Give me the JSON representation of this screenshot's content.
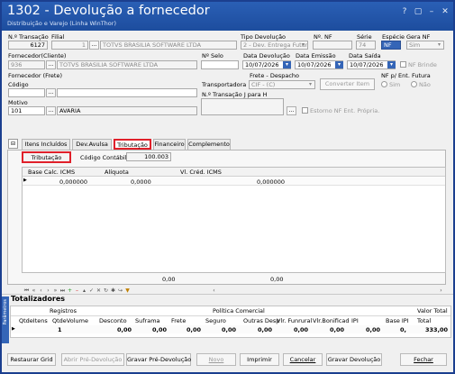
{
  "window": {
    "title": "1302 - Devolução a fornecedor",
    "subtitle": "Distribuição e Varejo (Linha WinThor)",
    "controls": [
      "?",
      "▢",
      "–",
      "✕"
    ]
  },
  "form": {
    "nr_transacao_label": "N.º Transação",
    "nr_transacao": "6127",
    "filial_label": "Filial",
    "filial_code": "1",
    "filial_name": "TOTVS BRASILIA SOFTWARE LTDA",
    "tipo_devolucao_label": "Tipo Devolução",
    "tipo_devolucao": "2 - Dev. Entrega Futur",
    "nr_nf_label": "Nº. NF",
    "serie_label": "Série",
    "serie": "74",
    "especie_label": "Espécie",
    "especie": "NF",
    "gera_nf_label": "Gera NF",
    "gera_nf": "Sim",
    "fornecedor_cliente_label": "Fornecedor(Cliente)",
    "fornecedor_code": "936",
    "fornecedor_name": "TOTVS BRASILIA SOFTWARE LTDA",
    "nr_selo_label": "Nº Selo",
    "data_devolucao_label": "Data Devolução",
    "data_devolucao": "10/07/2026",
    "data_emissao_label": "Data Emissão",
    "data_emissao": "10/07/2026",
    "data_saida_label": "Data Saída",
    "data_saida": "10/07/2026",
    "nf_brinde_label": "NF Brinde",
    "fornecedor_frete_label": "Fornecedor (Frete)",
    "codigo_label": "Código",
    "frete_despacho_label": "Frete - Despacho",
    "transportadora_label": "Transportadora",
    "frete_despacho": "CIF - (C)",
    "converter_item_label": "Converter Item",
    "nf_ent_futura_label": "NF p/ Ent. Futura",
    "sim_label": "Sim",
    "nao_label": "Não",
    "motivo_label": "Motivo",
    "motivo_code": "101",
    "motivo_desc": "AVARIA",
    "nr_transacao_j_label": "N.º Transação J para H",
    "estorno_label": "Estorno NF Ent. Própria.",
    "ellipsis": "..."
  },
  "tabs": [
    "Itens Incluídos",
    "Dev.Avulsa",
    "Tributação",
    "Financeiro",
    "Complemento"
  ],
  "tributacao": {
    "button_label": "Tributação",
    "codigo_contabil_label": "Código Contábil:",
    "codigo_contabil": "100.003"
  },
  "grid": {
    "columns": [
      "Base Calc. ICMS",
      "Alíquota",
      "Vl. Créd. ICMS"
    ],
    "row": [
      "0,000000",
      "0,0000",
      "0,000000"
    ],
    "footer_values": [
      "0,00",
      "0,00"
    ]
  },
  "totalizadores": {
    "title": "Totalizadores",
    "registros_label": "Registros",
    "politica_comercial_label": "Política Comercial",
    "valor_total_label": "Valor Total",
    "columns": [
      "QtdeItens",
      "QtdeVolume",
      "Desconto",
      "Suframa",
      "Frete",
      "Seguro",
      "Outras Desp",
      "Vlr. Funrural",
      "Vlr.Bonificad",
      "IPI",
      "Base IPI",
      "Total"
    ],
    "row": [
      "1",
      "",
      "0,00",
      "0,00",
      "0,00",
      "0,00",
      "0,00",
      "0,00",
      "0,00",
      "0,00",
      "0,",
      "333,00"
    ],
    "side_label": "Parâmetros"
  },
  "buttons": {
    "restaurar_grid": "Restaurar Grid",
    "abrir_pre_devolucao": "Abrir Pré-Devolução",
    "gravar_pre_devolucao": "Gravar Pré-Devolução",
    "novo": "Novo",
    "imprimir": "Imprimir",
    "cancelar": "Cancelar",
    "gravar_devolucao": "Gravar Devolução",
    "fechar": "Fechar"
  },
  "colors": {
    "titlebar": "#1d4d9e",
    "highlight": "#e0202a",
    "selected_field": "#3465b7"
  }
}
